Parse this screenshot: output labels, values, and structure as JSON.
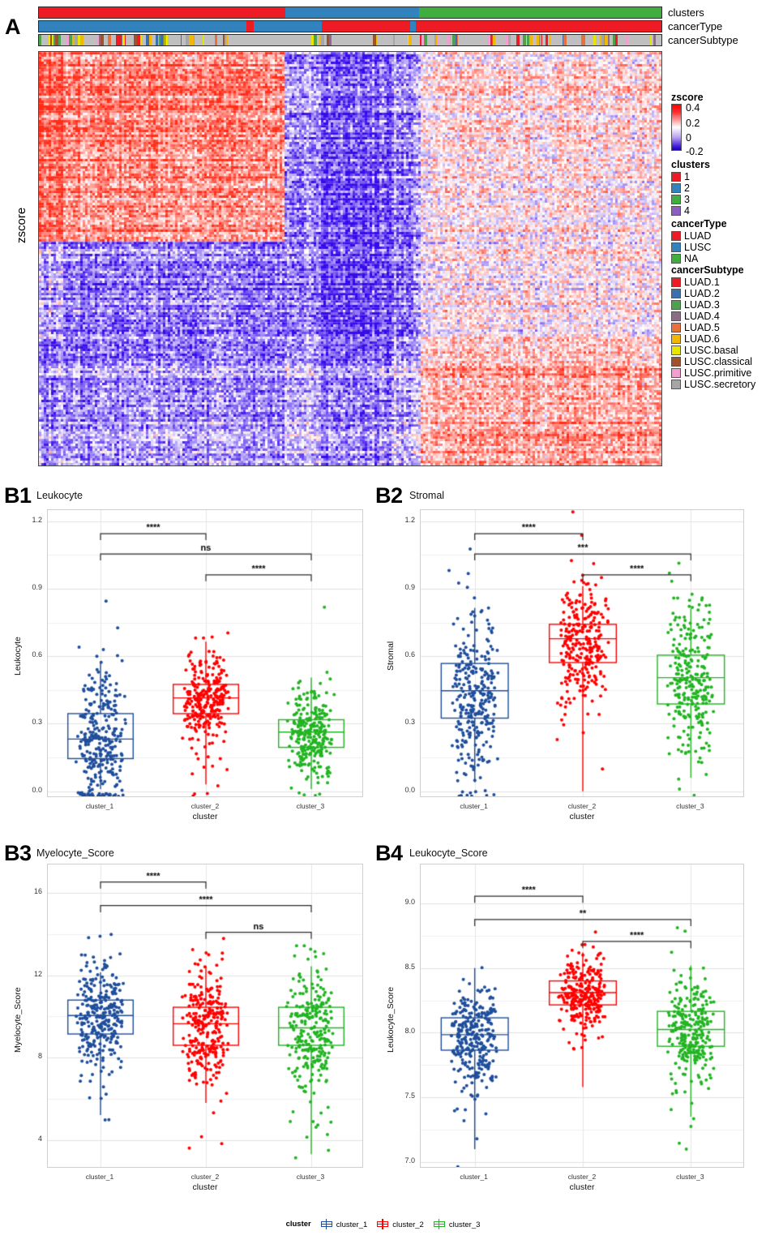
{
  "figure": {
    "panels": [
      "A",
      "B1",
      "B2",
      "B3",
      "B4"
    ]
  },
  "panelA": {
    "letter": "A",
    "yaxis_label": "zscore",
    "annotation_tracks": [
      {
        "name": "clusters",
        "segments": [
          {
            "label": "1",
            "color": "#ED1C24",
            "start": 0.0,
            "end": 0.396
          },
          {
            "label": "2",
            "color": "#3182BD",
            "start": 0.396,
            "end": 0.611
          },
          {
            "label": "3",
            "color": "#3FAE3F",
            "start": 0.611,
            "end": 1.0
          }
        ]
      },
      {
        "name": "cancerType",
        "segments": [
          {
            "label": "LUSC",
            "color": "#3182BD",
            "start": 0.0,
            "end": 0.333
          },
          {
            "label": "LUAD",
            "color": "#ED1C24",
            "start": 0.333,
            "end": 0.345
          },
          {
            "label": "LUSC",
            "color": "#3182BD",
            "start": 0.345,
            "end": 0.455
          },
          {
            "label": "LUAD",
            "color": "#ED1C24",
            "start": 0.455,
            "end": 0.597
          },
          {
            "label": "LUSC",
            "color": "#3182BD",
            "start": 0.597,
            "end": 0.606
          },
          {
            "label": "LUAD",
            "color": "#ED1C24",
            "start": 0.606,
            "end": 1.0
          }
        ]
      },
      {
        "name": "cancerSubtype",
        "segments": []
      }
    ],
    "legends": [
      {
        "title": "zscore",
        "type": "colorbar",
        "ticks": [
          "0.4",
          "0.2",
          "0",
          "-0.2"
        ],
        "gradient": [
          "#ff0000",
          "#ffffff",
          "#3a14d8"
        ]
      },
      {
        "title": "clusters",
        "type": "discrete",
        "items": [
          {
            "label": "1",
            "color": "#ED1C24"
          },
          {
            "label": "2",
            "color": "#3182BD"
          },
          {
            "label": "3",
            "color": "#3FAE3F"
          },
          {
            "label": "4",
            "color": "#8B5FBF"
          }
        ]
      },
      {
        "title": "cancerType",
        "type": "discrete",
        "items": [
          {
            "label": "LUAD",
            "color": "#ED1C24"
          },
          {
            "label": "LUSC",
            "color": "#3182BD"
          },
          {
            "label": "NA",
            "color": "#3FAE3F"
          }
        ]
      },
      {
        "title": "cancerSubtype",
        "type": "discrete",
        "items": [
          {
            "label": "LUAD.1",
            "color": "#ED1C24"
          },
          {
            "label": "LUAD.2",
            "color": "#3C6FB0"
          },
          {
            "label": "LUAD.3",
            "color": "#4EA24E"
          },
          {
            "label": "LUAD.4",
            "color": "#8B6E85"
          },
          {
            "label": "LUAD.5",
            "color": "#E8703A"
          },
          {
            "label": "LUAD.6",
            "color": "#F2B705"
          },
          {
            "label": "LUSC.basal",
            "color": "#E6E600"
          },
          {
            "label": "LUSC.classical",
            "color": "#A0522D"
          },
          {
            "label": "LUSC.primitive",
            "color": "#F29FD0"
          },
          {
            "label": "LUSC.secretory",
            "color": "#A6A6A6"
          }
        ]
      }
    ]
  },
  "cluster_colors": {
    "cluster_1": "#1F4E9C",
    "cluster_2": "#FF0000",
    "cluster_3": "#22B422"
  },
  "bottom_legend": {
    "title": "cluster",
    "items": [
      {
        "label": "cluster_1",
        "color": "#1F4E9C"
      },
      {
        "label": "cluster_2",
        "color": "#FF0000"
      },
      {
        "label": "cluster_3",
        "color": "#22B422"
      }
    ]
  },
  "chart_data": [
    {
      "panel": "B1",
      "letter": "B1",
      "type": "boxplot",
      "title": "Leukocyte",
      "xlabel": "cluster",
      "ylabel": "Leukocyte",
      "categories": [
        "cluster_1",
        "cluster_2",
        "cluster_3"
      ],
      "ylim": [
        -0.03,
        1.25
      ],
      "yticks": [
        0.0,
        0.3,
        0.6,
        0.9,
        1.2
      ],
      "ytick_labels": [
        "0.0",
        "0.3",
        "0.6",
        "0.9",
        "1.2"
      ],
      "grid": true,
      "boxes": [
        {
          "group": "cluster_1",
          "color": "#1F4E9C",
          "min": 0.01,
          "q1": 0.145,
          "median": 0.232,
          "q3": 0.345,
          "max": 0.575,
          "n": 300
        },
        {
          "group": "cluster_2",
          "color": "#FF0000",
          "min": 0.03,
          "q1": 0.345,
          "median": 0.415,
          "q3": 0.475,
          "max": 0.665,
          "n": 280
        },
        {
          "group": "cluster_3",
          "color": "#22B422",
          "min": 0.01,
          "q1": 0.195,
          "median": 0.263,
          "q3": 0.318,
          "max": 0.505,
          "n": 270
        }
      ],
      "comparisons": [
        {
          "groups": [
            "cluster_1",
            "cluster_2"
          ],
          "label": "****",
          "y": 1.145
        },
        {
          "groups": [
            "cluster_1",
            "cluster_3"
          ],
          "label": "ns",
          "y": 1.055
        },
        {
          "groups": [
            "cluster_2",
            "cluster_3"
          ],
          "label": "****",
          "y": 0.962
        }
      ]
    },
    {
      "panel": "B2",
      "letter": "B2",
      "type": "boxplot",
      "title": "Stromal",
      "xlabel": "cluster",
      "ylabel": "Stromal",
      "categories": [
        "cluster_1",
        "cluster_2",
        "cluster_3"
      ],
      "ylim": [
        -0.03,
        1.25
      ],
      "yticks": [
        0.0,
        0.3,
        0.6,
        0.9,
        1.2
      ],
      "ytick_labels": [
        "0.0",
        "0.3",
        "0.6",
        "0.9",
        "1.2"
      ],
      "grid": true,
      "boxes": [
        {
          "group": "cluster_1",
          "color": "#1F4E9C",
          "min": 0.04,
          "q1": 0.325,
          "median": 0.447,
          "q3": 0.568,
          "max": 0.815,
          "n": 300
        },
        {
          "group": "cluster_2",
          "color": "#FF0000",
          "min": 0.0,
          "q1": 0.572,
          "median": 0.678,
          "q3": 0.742,
          "max": 0.912,
          "n": 280
        },
        {
          "group": "cluster_3",
          "color": "#22B422",
          "min": 0.06,
          "q1": 0.388,
          "median": 0.505,
          "q3": 0.605,
          "max": 0.812,
          "n": 270
        }
      ],
      "comparisons": [
        {
          "groups": [
            "cluster_1",
            "cluster_2"
          ],
          "label": "****",
          "y": 1.145
        },
        {
          "groups": [
            "cluster_1",
            "cluster_3"
          ],
          "label": "***",
          "y": 1.055
        },
        {
          "groups": [
            "cluster_2",
            "cluster_3"
          ],
          "label": "****",
          "y": 0.962
        }
      ]
    },
    {
      "panel": "B3",
      "letter": "B3",
      "type": "boxplot",
      "title": "Myelocyte_Score",
      "xlabel": "cluster",
      "ylabel": "Myelocyte_Score",
      "categories": [
        "cluster_1",
        "cluster_2",
        "cluster_3"
      ],
      "ylim": [
        2.6,
        17.4
      ],
      "yticks": [
        4,
        8,
        12,
        16
      ],
      "ytick_labels": [
        "4",
        "8",
        "12",
        "16"
      ],
      "grid": true,
      "boxes": [
        {
          "group": "cluster_1",
          "color": "#1F4E9C",
          "min": 5.2,
          "q1": 9.15,
          "median": 10.05,
          "q3": 10.8,
          "max": 12.15,
          "n": 300
        },
        {
          "group": "cluster_2",
          "color": "#FF0000",
          "min": 5.8,
          "q1": 8.6,
          "median": 9.65,
          "q3": 10.45,
          "max": 12.45,
          "n": 280
        },
        {
          "group": "cluster_3",
          "color": "#22B422",
          "min": 3.3,
          "q1": 8.6,
          "median": 9.45,
          "q3": 10.45,
          "max": 12.45,
          "n": 270
        }
      ],
      "comparisons": [
        {
          "groups": [
            "cluster_1",
            "cluster_2"
          ],
          "label": "****",
          "y": 16.55
        },
        {
          "groups": [
            "cluster_1",
            "cluster_3"
          ],
          "label": "****",
          "y": 15.4
        },
        {
          "groups": [
            "cluster_2",
            "cluster_3"
          ],
          "label": "ns",
          "y": 14.1
        }
      ]
    },
    {
      "panel": "B4",
      "letter": "B4",
      "type": "boxplot",
      "title": "Leukocyte_Score",
      "xlabel": "cluster",
      "ylabel": "Leukocyte_Score",
      "categories": [
        "cluster_1",
        "cluster_2",
        "cluster_3"
      ],
      "ylim": [
        6.95,
        9.3
      ],
      "yticks": [
        7.0,
        7.5,
        8.0,
        8.5,
        9.0
      ],
      "ytick_labels": [
        "7.0",
        "7.5",
        "8.0",
        "8.5",
        "9.0"
      ],
      "grid": true,
      "boxes": [
        {
          "group": "cluster_1",
          "color": "#1F4E9C",
          "min": 7.1,
          "q1": 7.865,
          "median": 7.985,
          "q3": 8.115,
          "max": 8.5,
          "n": 300
        },
        {
          "group": "cluster_2",
          "color": "#FF0000",
          "min": 7.58,
          "q1": 8.215,
          "median": 8.31,
          "q3": 8.4,
          "max": 8.62,
          "n": 280
        },
        {
          "group": "cluster_3",
          "color": "#22B422",
          "min": 7.35,
          "q1": 7.895,
          "median": 8.025,
          "q3": 8.165,
          "max": 8.52,
          "n": 270
        }
      ],
      "comparisons": [
        {
          "groups": [
            "cluster_1",
            "cluster_2"
          ],
          "label": "****",
          "y": 9.055
        },
        {
          "groups": [
            "cluster_1",
            "cluster_3"
          ],
          "label": "**",
          "y": 8.875
        },
        {
          "groups": [
            "cluster_2",
            "cluster_3"
          ],
          "label": "****",
          "y": 8.705
        }
      ]
    }
  ]
}
